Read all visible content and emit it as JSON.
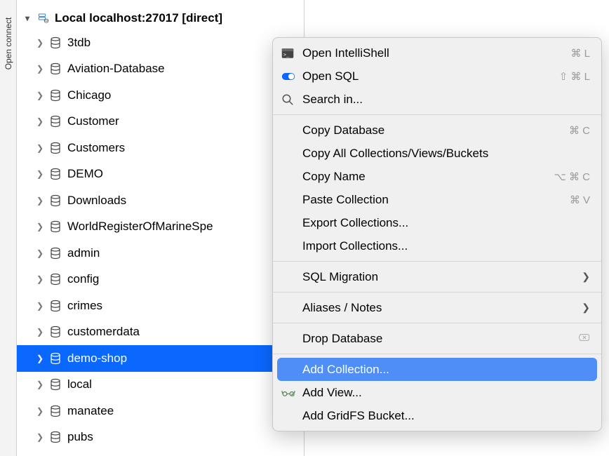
{
  "rail": {
    "label": "Open connect"
  },
  "connection": {
    "label": "Local localhost:27017 [direct]"
  },
  "tree": {
    "items": [
      {
        "label": "3tdb",
        "selected": false
      },
      {
        "label": "Aviation-Database",
        "selected": false
      },
      {
        "label": "Chicago",
        "selected": false
      },
      {
        "label": "Customer",
        "selected": false
      },
      {
        "label": "Customers",
        "selected": false
      },
      {
        "label": "DEMO",
        "selected": false
      },
      {
        "label": "Downloads",
        "selected": false
      },
      {
        "label": "WorldRegisterOfMarineSpe",
        "selected": false
      },
      {
        "label": "admin",
        "selected": false
      },
      {
        "label": "config",
        "selected": false
      },
      {
        "label": "crimes",
        "selected": false
      },
      {
        "label": "customerdata",
        "selected": false
      },
      {
        "label": "demo-shop",
        "selected": true
      },
      {
        "label": "local",
        "selected": false
      },
      {
        "label": "manatee",
        "selected": false
      },
      {
        "label": "pubs",
        "selected": false
      }
    ]
  },
  "menu": {
    "items": [
      {
        "label": "Open IntelliShell",
        "icon": "terminal",
        "shortcut": "⌘ L"
      },
      {
        "label": "Open SQL",
        "icon": "toggle",
        "shortcut": "⇧ ⌘ L"
      },
      {
        "label": "Search in...",
        "icon": "search"
      },
      {
        "sep": true
      },
      {
        "label": "Copy Database",
        "shortcut": "⌘ C"
      },
      {
        "label": "Copy All Collections/Views/Buckets"
      },
      {
        "label": "Copy Name",
        "shortcut": "⌥ ⌘ C"
      },
      {
        "label": "Paste Collection",
        "shortcut": "⌘ V"
      },
      {
        "label": "Export Collections..."
      },
      {
        "label": "Import Collections..."
      },
      {
        "sep": true
      },
      {
        "label": "SQL Migration",
        "submenu": true
      },
      {
        "sep": true
      },
      {
        "label": "Aliases / Notes",
        "submenu": true
      },
      {
        "sep": true
      },
      {
        "label": "Drop Database",
        "trailing_icon": "delete-outline"
      },
      {
        "sep": true
      },
      {
        "label": "Add Collection...",
        "highlight": true
      },
      {
        "label": "Add View...",
        "icon": "glasses"
      },
      {
        "label": "Add GridFS Bucket..."
      }
    ]
  }
}
